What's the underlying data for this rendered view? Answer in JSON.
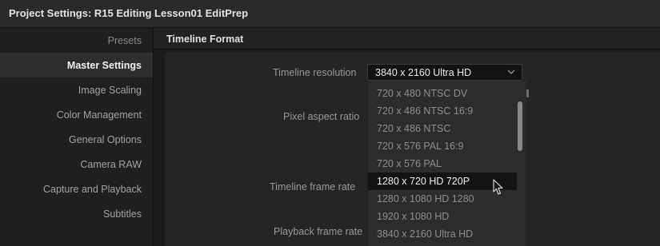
{
  "window": {
    "title": "Project Settings:  R15 Editing Lesson01 EditPrep"
  },
  "sidebar": {
    "header": "Presets",
    "items": [
      {
        "label": "Master Settings",
        "active": true
      },
      {
        "label": "Image Scaling",
        "active": false
      },
      {
        "label": "Color Management",
        "active": false
      },
      {
        "label": "General Options",
        "active": false
      },
      {
        "label": "Camera RAW",
        "active": false
      },
      {
        "label": "Capture and Playback",
        "active": false
      },
      {
        "label": "Subtitles",
        "active": false
      }
    ]
  },
  "main": {
    "section_title": "Timeline Format",
    "fields": {
      "timeline_resolution": "Timeline resolution",
      "pixel_aspect_ratio": "Pixel aspect ratio",
      "timeline_frame_rate": "Timeline frame rate",
      "playback_frame_rate": "Playback frame rate"
    },
    "resolution_select": {
      "value": "3840 x 2160 Ultra HD",
      "icon": "chevron-down-icon"
    },
    "resolution_options": [
      "720 x 480 NTSC DV",
      "720 x 486 NTSC 16:9",
      "720 x 486 NTSC",
      "720 x 576 PAL 16:9",
      "720 x 576 PAL",
      "1280 x 720 HD 720P",
      "1280 x 1080 HD 1280",
      "1920 x 1080 HD",
      "3840 x 2160 Ultra HD"
    ],
    "highlighted_option": "1280 x 720 HD 720P"
  },
  "colors": {
    "accent_text": "#ececee",
    "window_bg": "#1a1a1b"
  }
}
